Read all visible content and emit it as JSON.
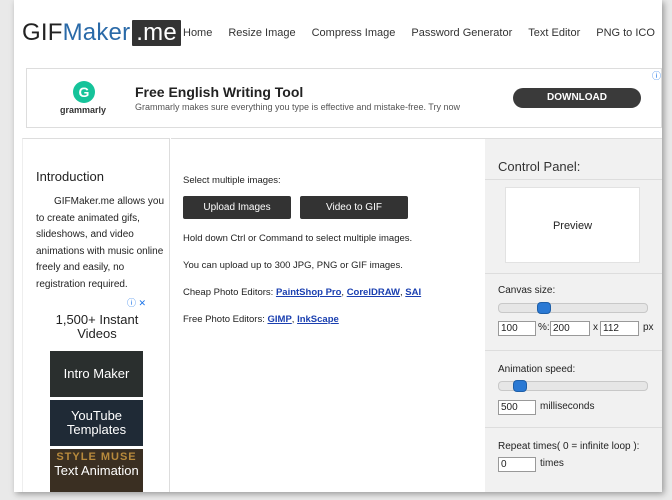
{
  "header": {
    "logo_gif": "GIF",
    "logo_maker": "Maker",
    "logo_me": ".me",
    "nav": [
      "Home",
      "Resize Image",
      "Compress Image",
      "Password Generator",
      "Text Editor",
      "PNG to ICO"
    ]
  },
  "ad_banner": {
    "logo_letter": "G",
    "logo_text": "grammarly",
    "title": "Free English Writing Tool",
    "subtitle": "Grammarly makes sure everything you type is effective and mistake-free. Try now",
    "button": "DOWNLOAD"
  },
  "left": {
    "intro_title": "Introduction",
    "intro_text": "GIFMaker.me allows you to create animated gifs, slideshows, and video animations with music online freely and easily, no registration required.",
    "ad_title": "1,500+ Instant Videos",
    "thumbs": [
      "Intro Maker",
      "YouTube Templates",
      "Text Animation"
    ],
    "thumb3_deco": "STYLE MUSE"
  },
  "main": {
    "select_label": "Select multiple images:",
    "upload_button": "Upload Images",
    "video_button": "Video to GIF",
    "hint1": "Hold down Ctrl or Command to select multiple images.",
    "hint2": "You can upload up to 300 JPG, PNG or GIF images.",
    "cheap_label": "Cheap Photo Editors:",
    "cheap_links": [
      "PaintShop Pro",
      "CorelDRAW",
      "SAI"
    ],
    "free_label": "Free Photo Editors:",
    "free_links": [
      "GIMP",
      "InkScape"
    ]
  },
  "control_panel": {
    "title": "Control Panel:",
    "preview": "Preview",
    "canvas_label": "Canvas size:",
    "canvas_slider_value": 0.28,
    "canvas_percent": "100",
    "percent_sign": "%:",
    "canvas_width": "200",
    "x_sep": "x",
    "canvas_height": "112",
    "px_unit": "px",
    "speed_label": "Animation speed:",
    "speed_slider_value": 0.1,
    "speed_value": "500",
    "speed_unit": "milliseconds",
    "repeat_label": "Repeat times( 0 = infinite loop ):",
    "repeat_value": "0",
    "repeat_unit": "times"
  }
}
